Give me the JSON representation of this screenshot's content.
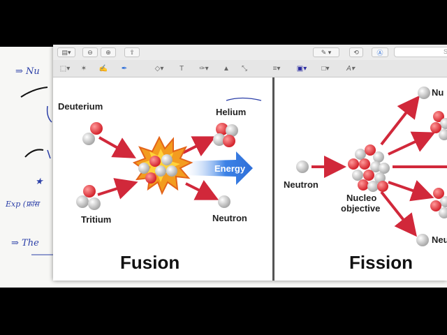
{
  "background_notes": {
    "note_1": "⇒ Nu",
    "note_2": "★",
    "note_3": "Exp (फ्रांस",
    "note_4": "⇒ The"
  },
  "toolbar": {
    "search_placeholder": "S"
  },
  "diagram": {
    "fusion": {
      "title": "Fusion",
      "deuterium_label": "Deuterium",
      "tritium_label": "Tritium",
      "helium_label": "Helium",
      "neutron_label": "Neutron",
      "energy_label": "Energy"
    },
    "fission": {
      "title": "Fission",
      "neutron_label": "Neutron",
      "nucleus_label_line1": "Nucleo",
      "nucleus_label_line2": "objective",
      "product_top_label": "Nu",
      "product_bottom_label": "Neu"
    }
  },
  "colors": {
    "proton": "#e8323a",
    "neutron": "#d6d6d6",
    "arrow": "#d1283a",
    "energy_arrow": "#2f6fd8",
    "ink": "#2b3fa8"
  }
}
